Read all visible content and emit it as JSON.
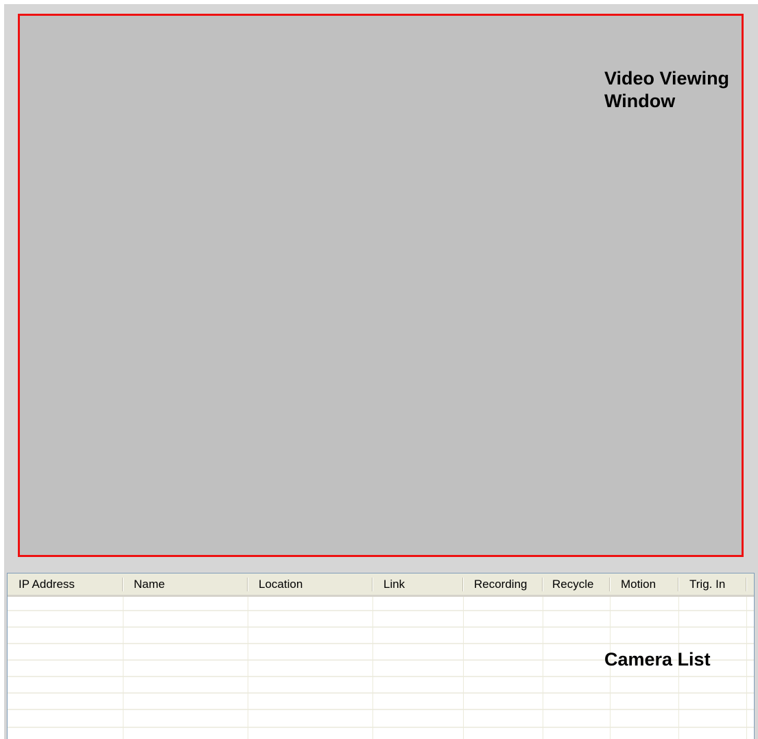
{
  "video_window": {
    "label": "Video Viewing\nWindow"
  },
  "camera_list": {
    "label": "Camera List",
    "columns": [
      "IP Address",
      "Name",
      "Location",
      "Link",
      "Recording",
      "Recycle",
      "Motion",
      "Trig. In"
    ]
  },
  "colors": {
    "highlight_border": "#ee1111",
    "video_background": "#c0c0c0",
    "header_background": "#ebeadb"
  }
}
